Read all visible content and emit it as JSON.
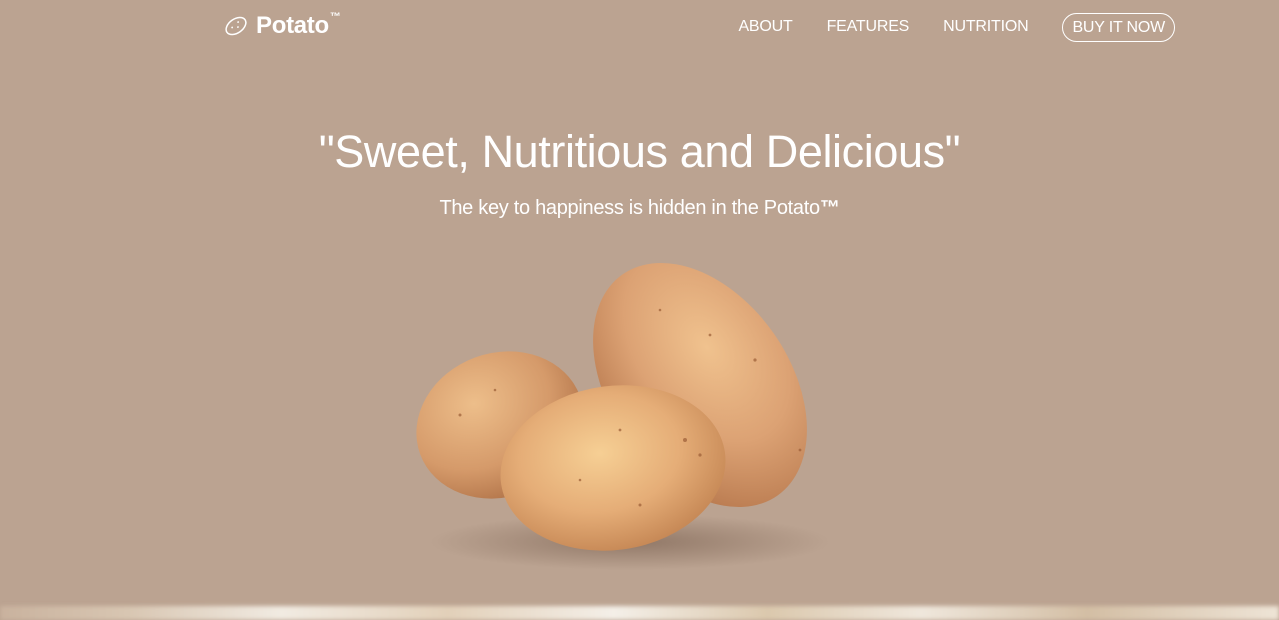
{
  "brand": {
    "name": "Potato",
    "tm": "™",
    "icon": "potato-icon"
  },
  "nav": {
    "items": [
      {
        "label": "ABOUT"
      },
      {
        "label": "FEATURES"
      },
      {
        "label": "NUTRITION"
      }
    ],
    "cta": "BUY IT NOW"
  },
  "hero": {
    "title": "\"Sweet, Nutritious and Delicious\"",
    "subtitle": "The key to happiness is hidden in the Potato",
    "subtitle_tm": "™"
  },
  "colors": {
    "background": "#bba391",
    "potato_skin": "#dca274",
    "text": "#ffffff"
  }
}
